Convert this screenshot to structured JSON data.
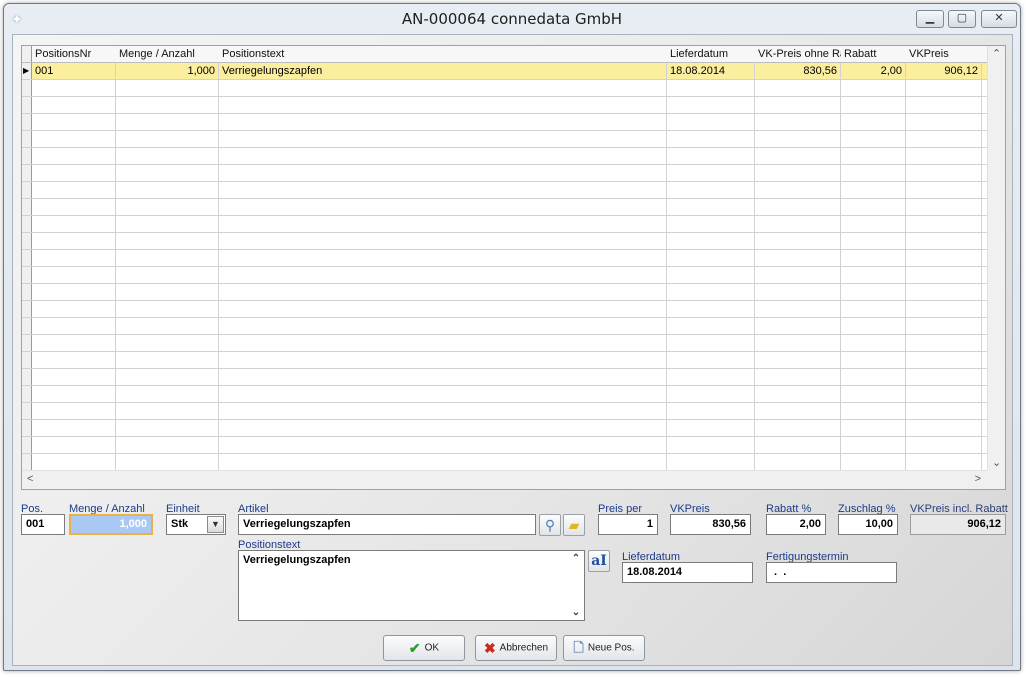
{
  "window": {
    "title": "AN-000064 connedata GmbH",
    "app_icon": "app-icon",
    "controls": {
      "minimize": "▭",
      "maximize": "▢",
      "close": "✕"
    }
  },
  "grid": {
    "columns": [
      "PositionsNr",
      "Menge / Anzahl",
      "Positionstext",
      "Lieferdatum",
      "VK-Preis ohne Ra",
      "Rabatt",
      "VKPreis"
    ],
    "rows": [
      {
        "pos": "001",
        "menge": "1,000",
        "text": "Verriegelungszapfen",
        "lieferdatum": "18.08.2014",
        "vk_ohne_rabatt": "830,56",
        "rabatt": "2,00",
        "vkpreis": "906,12"
      }
    ],
    "selected_color": "#fbef9f"
  },
  "form": {
    "pos_label": "Pos.",
    "pos_value": "001",
    "menge_label": "Menge / Anzahl",
    "menge_value": "1,000",
    "einheit_label": "Einheit",
    "einheit_value": "Stk",
    "artikel_label": "Artikel",
    "artikel_value": "Verriegelungszapfen",
    "preis_per_label": "Preis per",
    "preis_per_value": "1",
    "vkpreis_label": "VKPreis",
    "vkpreis_value": "830,56",
    "rabatt_label": "Rabatt %",
    "rabatt_value": "2,00",
    "zuschlag_label": "Zuschlag %",
    "zuschlag_value": "10,00",
    "vkpreis_incl_label": "VKPreis incl. Rabatt",
    "vkpreis_incl_value": "906,12",
    "positionstext_label": "Positionstext",
    "positionstext_value": "Verriegelungszapfen",
    "lieferdatum_label": "Lieferdatum",
    "lieferdatum_value": "18.08.2014",
    "fertigung_label": "Fertigungstermin",
    "fertigung_value": " .  ."
  },
  "buttons": {
    "ok": "OK",
    "abbrechen": "Abbrechen",
    "neue_pos": "Neue Pos."
  }
}
